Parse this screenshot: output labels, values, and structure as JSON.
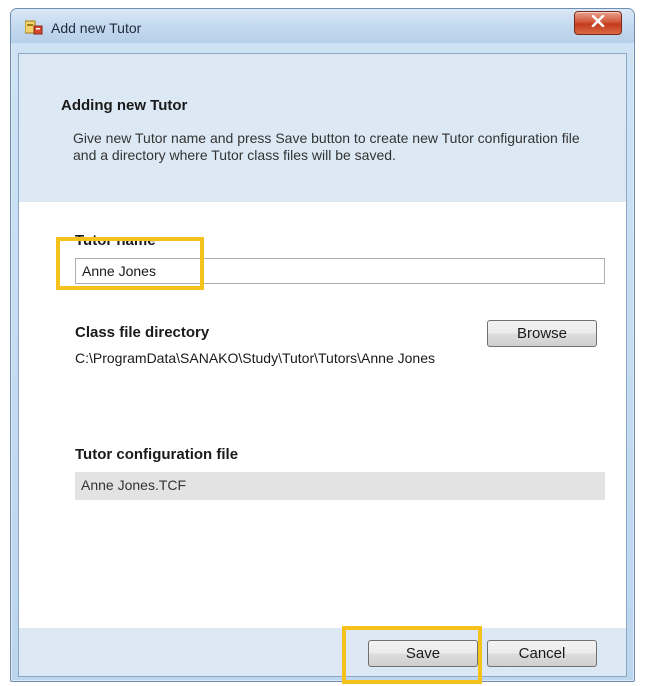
{
  "window": {
    "title": "Add new Tutor",
    "close_label": "x"
  },
  "header": {
    "heading": "Adding new Tutor",
    "description": "Give new Tutor name and press Save button to create new Tutor configuration file and a directory where Tutor class files will be saved."
  },
  "form": {
    "tutor_name_label": "Tutor name",
    "tutor_name_value": "Anne Jones",
    "class_dir_label": "Class file directory",
    "browse_label": "Browse",
    "class_dir_path": "C:\\ProgramData\\SANAKO\\Study\\Tutor\\Tutors\\Anne Jones",
    "config_file_label": "Tutor configuration file",
    "config_file_value": "Anne Jones.TCF"
  },
  "footer": {
    "save_label": "Save",
    "cancel_label": "Cancel"
  },
  "colors": {
    "highlight": "#f4c21a",
    "header_band": "#dce9f5",
    "close_button": "#c43b1c"
  },
  "icons": {
    "title": "app-window-icon",
    "close": "close-icon"
  }
}
